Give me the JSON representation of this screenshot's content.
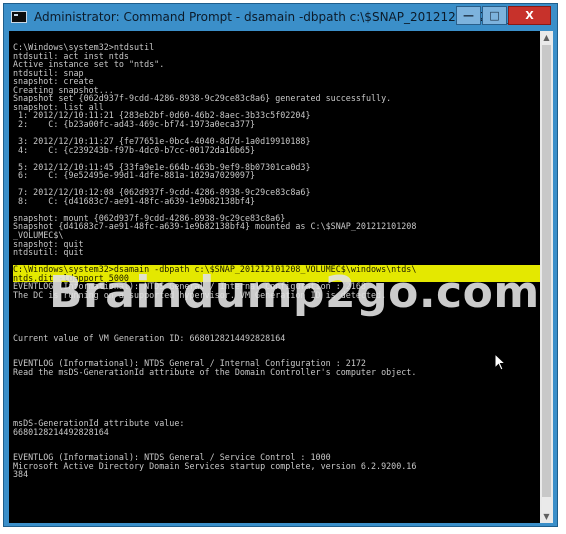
{
  "window": {
    "title": "Administrator: Command Prompt - dsamain  -dbpath c:\\$SNAP_201212101208_...",
    "minimize_label": "—",
    "maximize_label": "□",
    "close_label": "X"
  },
  "console": {
    "lines": [
      {
        "text": "C:\\Windows\\system32>ntdsutil",
        "highlight": false
      },
      {
        "text": "ntdsutil: act inst ntds",
        "highlight": false
      },
      {
        "text": "Active instance set to \"ntds\".",
        "highlight": false
      },
      {
        "text": "ntdsutil: snap",
        "highlight": false
      },
      {
        "text": "snapshot: create",
        "highlight": false
      },
      {
        "text": "Creating snapshot...",
        "highlight": false
      },
      {
        "text": "Snapshot set {062d937f-9cdd-4286-8938-9c29ce83c8a6} generated successfully.",
        "highlight": false
      },
      {
        "text": "snapshot: list all",
        "highlight": false
      },
      {
        "text": " 1: 2012/12/10:11:21 {283eb2bf-0d60-46b2-8aec-3b33c5f02204}",
        "highlight": false
      },
      {
        "text": " 2:    C: {b23a00fc-ad43-469c-bf74-1973a0eca377}",
        "highlight": false
      },
      {
        "text": "",
        "highlight": false
      },
      {
        "text": " 3: 2012/12/10:11:27 {fe77651e-0bc4-4040-8d7d-1a0d19910188}",
        "highlight": false
      },
      {
        "text": " 4:    C: {c239243b-f97b-4dc0-b7cc-00172da16b65}",
        "highlight": false
      },
      {
        "text": "",
        "highlight": false
      },
      {
        "text": " 5: 2012/12/10:11:45 {33fa9e1e-664b-463b-9ef9-8b07301ca0d3}",
        "highlight": false
      },
      {
        "text": " 6:    C: {9e52495e-99d1-4dfe-881a-1029a7029097}",
        "highlight": false
      },
      {
        "text": "",
        "highlight": false
      },
      {
        "text": " 7: 2012/12/10:12:08 {062d937f-9cdd-4286-8938-9c29ce83c8a6}",
        "highlight": false
      },
      {
        "text": " 8:    C: {d41683c7-ae91-48fc-a639-1e9b82138bf4}",
        "highlight": false
      },
      {
        "text": "",
        "highlight": false
      },
      {
        "text": "snapshot: mount {062d937f-9cdd-4286-8938-9c29ce83c8a6}",
        "highlight": false
      },
      {
        "text": "Snapshot {d41683c7-ae91-48fc-a639-1e9b82138bf4} mounted as C:\\$SNAP_201212101208",
        "highlight": false
      },
      {
        "text": "_VOLUMEC$\\",
        "highlight": false
      },
      {
        "text": "snapshot: quit",
        "highlight": false
      },
      {
        "text": "ntdsutil: quit",
        "highlight": false
      },
      {
        "text": "",
        "highlight": false
      },
      {
        "text": "C:\\Windows\\system32>dsamain -dbpath c:\\$SNAP_201212101208_VOLUMEC$\\windows\\ntds\\",
        "highlight": true
      },
      {
        "text": "ntds.dit -ldapport 5000",
        "highlight": true
      },
      {
        "text": "EVENTLOG (Informational): NTDS General / Internal Configuration : 2168",
        "highlight": false
      },
      {
        "text": "The DC is running on a supported hypervisor. VM Generation ID is detected.",
        "highlight": false
      },
      {
        "text": "",
        "highlight": false
      },
      {
        "text": "",
        "highlight": false
      },
      {
        "text": "",
        "highlight": false
      },
      {
        "text": "",
        "highlight": false
      },
      {
        "text": "Current value of VM Generation ID: 6680128214492828164",
        "highlight": false
      },
      {
        "text": "",
        "highlight": false
      },
      {
        "text": "",
        "highlight": false
      },
      {
        "text": "EVENTLOG (Informational): NTDS General / Internal Configuration : 2172",
        "highlight": false
      },
      {
        "text": "Read the msDS-GenerationId attribute of the Domain Controller's computer object.",
        "highlight": false
      },
      {
        "text": "",
        "highlight": false
      },
      {
        "text": "",
        "highlight": false
      },
      {
        "text": "",
        "highlight": false
      },
      {
        "text": "",
        "highlight": false
      },
      {
        "text": "",
        "highlight": false
      },
      {
        "text": "msDS-GenerationId attribute value:",
        "highlight": false
      },
      {
        "text": "6680128214492828164",
        "highlight": false
      },
      {
        "text": "",
        "highlight": false
      },
      {
        "text": "",
        "highlight": false
      },
      {
        "text": "EVENTLOG (Informational): NTDS General / Service Control : 1000",
        "highlight": false
      },
      {
        "text": "Microsoft Active Directory Domain Services startup complete, version 6.2.9200.16",
        "highlight": false
      },
      {
        "text": "384",
        "highlight": false
      }
    ]
  },
  "watermark": {
    "text": "Braindump2go.com"
  }
}
